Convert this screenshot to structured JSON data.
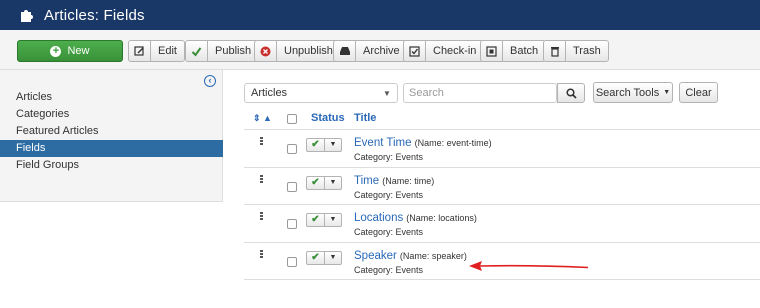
{
  "header": {
    "title": "Articles: Fields",
    "icon": "puzzle-icon",
    "bg": "#1a3867"
  },
  "toolbar": {
    "new": "New",
    "edit": "Edit",
    "publish": "Publish",
    "unpublish": "Unpublish",
    "archive": "Archive",
    "checkin": "Check-in",
    "batch": "Batch",
    "trash": "Trash"
  },
  "sidebar": {
    "items": [
      {
        "label": "Articles"
      },
      {
        "label": "Categories"
      },
      {
        "label": "Featured Articles"
      },
      {
        "label": "Fields"
      },
      {
        "label": "Field Groups"
      }
    ],
    "active": "Fields"
  },
  "filters": {
    "context": "Articles",
    "search_placeholder": "Search",
    "search_tools": "Search Tools",
    "clear": "Clear"
  },
  "table": {
    "headers": {
      "status": "Status",
      "title": "Title"
    },
    "rows": [
      {
        "title": "Event Time",
        "name": "(Name: event-time)",
        "category": "Category: Events"
      },
      {
        "title": "Time",
        "name": "(Name: time)",
        "category": "Category: Events"
      },
      {
        "title": "Locations",
        "name": "(Name: locations)",
        "category": "Category: Events"
      },
      {
        "title": "Speaker",
        "name": "(Name: speaker)",
        "category": "Category: Events"
      }
    ]
  },
  "colors": {
    "accent": "#2a69b8",
    "active_nav": "#2d6ca2",
    "new_btn": "#42a342",
    "annotation_arrow": "#e02020"
  }
}
